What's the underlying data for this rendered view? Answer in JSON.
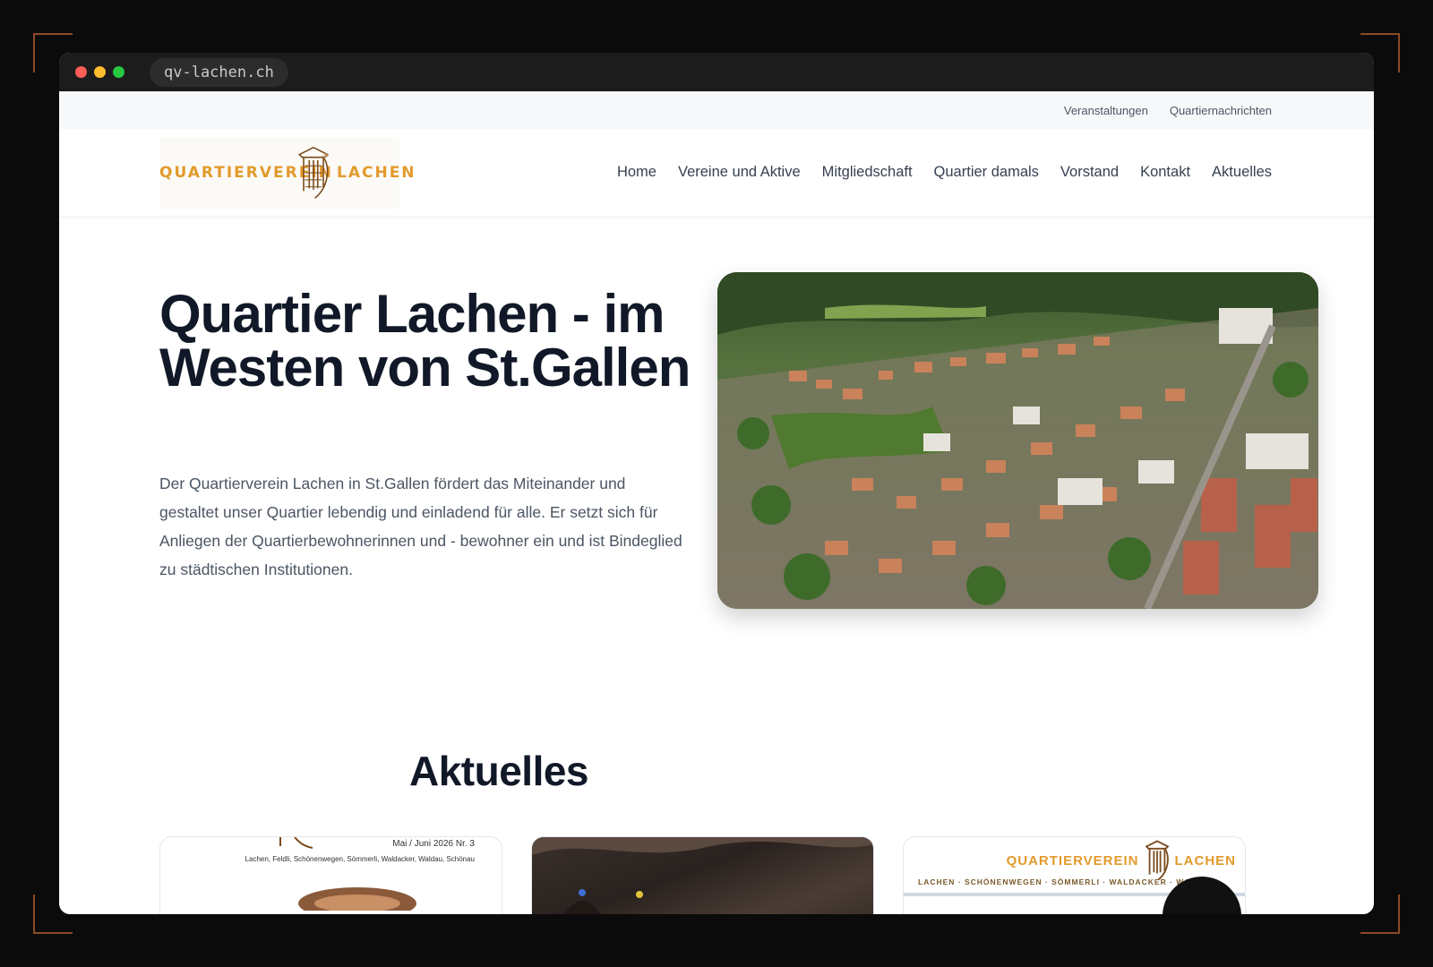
{
  "browser": {
    "url": "qv-lachen.ch"
  },
  "topbar": {
    "links": [
      "Veranstaltungen",
      "Quartiernachrichten"
    ]
  },
  "header": {
    "logo_left": "QUARTIERVEREIN",
    "logo_right": "LACHEN",
    "nav": [
      "Home",
      "Vereine und Aktive",
      "Mitgliedschaft",
      "Quartier damals",
      "Vorstand",
      "Kontakt",
      "Aktuelles"
    ]
  },
  "hero": {
    "title": "Quartier Lachen - im Westen von St.Gallen",
    "text": "Der Quartierverein Lachen in St.Gallen fördert das Miteinander und gestaltet unser Quartier lebendig und einladend für alle. Er setzt sich für Anliegen der Quartierbewohnerinnen und - bewohner ein und ist Bindeglied zu städtischen Institutionen."
  },
  "news": {
    "title": "Aktuelles",
    "card1": {
      "issue": "Mai / Juni 2026  Nr. 3",
      "areas": "Lachen, Feldli, Schönenwegen, Sömmerli, Waldacker, Waldau, Schönau"
    },
    "card3": {
      "logo_left": "QUARTIERVEREIN",
      "logo_right": "LACHEN",
      "areas": "LACHEN · SCHÖNENWEGEN · SÖMMERLI · WALDACKER · WALDAU"
    }
  },
  "colors": {
    "brand_orange": "#e39a2c",
    "heading": "#111827",
    "body_text": "#4b5563"
  }
}
